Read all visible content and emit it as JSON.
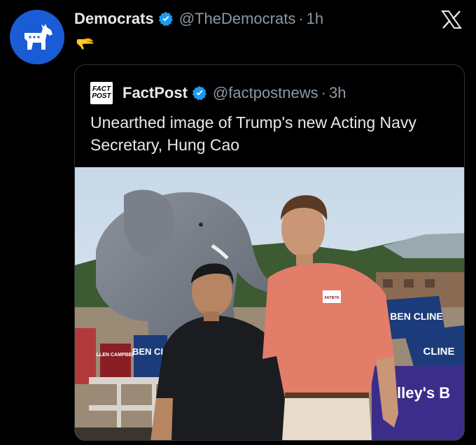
{
  "tweet": {
    "author_name": "Democrats",
    "author_handle": "@TheDemocrats",
    "separator": "·",
    "time": "1h",
    "body_emoji": "🫳"
  },
  "quoted_tweet": {
    "logo_line1": "FACT",
    "logo_line2": "POST",
    "author_name": "FactPost",
    "author_handle": "@factpostnews",
    "separator": "·",
    "time": "3h",
    "text": "Unearthed image of Trump's new Acting Navy Secretary, Hung Cao"
  },
  "photo": {
    "sign_ben_cline_left": "BEN CLI",
    "sign_ellen": "ELLEN CAMPBELL",
    "sign_ben_cline_right": "BEN CLINE",
    "sign_cline_lower": "CLINE",
    "banner": "alley's B",
    "shirt_logo": "ANTIETA"
  },
  "colors": {
    "brand_blue": "#1a5bd6",
    "verified_blue": "#1d9bf0",
    "text_primary": "#e7e9ea",
    "text_secondary": "#8b98a5",
    "border": "#2f3336"
  },
  "icons": {
    "avatar": "donkey-logo-icon",
    "verified": "verified-badge-icon",
    "platform": "x-logo-icon"
  }
}
